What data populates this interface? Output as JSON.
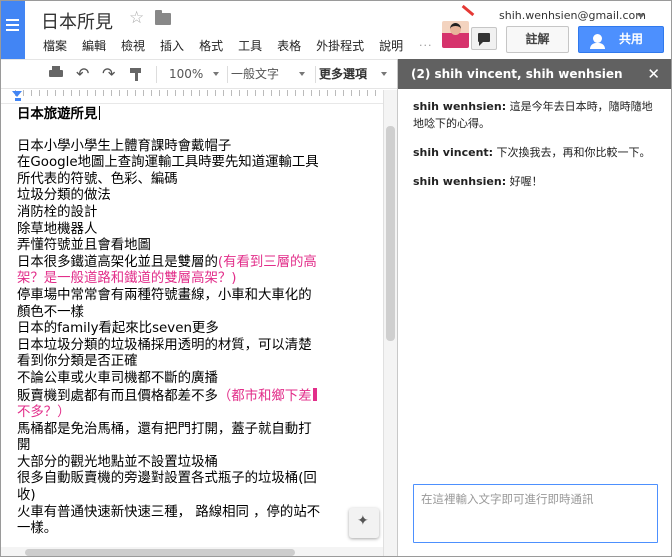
{
  "doc": {
    "title": "日本所見",
    "heading": "日本旅遊所見",
    "lines": [
      {
        "text": "日本小學小學生上體育課時會戴帽子"
      },
      {
        "text": "在Google地圖上查詢運輸工具時要先知道運輸工具"
      },
      {
        "text": "所代表的符號、色彩、編碼"
      },
      {
        "text": "垃圾分類的做法"
      },
      {
        "text": "消防栓的設計"
      },
      {
        "text": "除草地機器人"
      },
      {
        "text": "弄懂符號並且會看地圖"
      },
      {
        "text": "日本很多鐵道高架化並且是雙層的",
        "pink": "(有看到三層的高"
      },
      {
        "pink": "架？是一般道路和鐵道的雙層高架？)"
      },
      {
        "text": "停車場中常常會有兩種符號畫線，小車和大車化的"
      },
      {
        "text": "顏色不一樣"
      },
      {
        "text": "日本的family看起來比seven更多"
      },
      {
        "text": "日本垃圾分類的垃圾桶採用透明的材質，可以清楚"
      },
      {
        "text": "看到你分類是否正確"
      },
      {
        "text": "不論公車或火車司機都不斷的廣播"
      },
      {
        "text": "販賣機到處都有而且價格都差不多",
        "pink": "（都市和鄉下差",
        "cursor": true
      },
      {
        "pink": "不多？）"
      },
      {
        "text": "馬桶都是免治馬桶，還有把門打開，蓋子就自動打"
      },
      {
        "text": "開"
      },
      {
        "text": "大部分的觀光地點並不設置垃圾桶"
      },
      {
        "text": "很多自動販賣機的旁邊對設置各式瓶子的垃圾桶(回"
      },
      {
        "text": "收)"
      },
      {
        "text": "火車有普通快速新快速三種， 路線相同 ，停的站不"
      },
      {
        "text": "一樣。"
      }
    ]
  },
  "menu": [
    "檔案",
    "編輯",
    "檢視",
    "插入",
    "格式",
    "工具",
    "表格",
    "外掛程式",
    "說明"
  ],
  "header": {
    "email": "shih.wenhsien@gmail.com",
    "more": "···",
    "comments_label": "註解",
    "share_label": "共用"
  },
  "toolbar": {
    "zoom": "100%",
    "style": "一般文字",
    "more": "更多選項"
  },
  "chat": {
    "title": "(2) shih vincent, shih wenhsien",
    "close": "✕",
    "messages": [
      {
        "author": "shih wenhsien:",
        "text": " 這是今年去日本時，隨時隨地地唸下的心得。"
      },
      {
        "author": "shih vincent:",
        "text": " 下次換我去，再和你比較一下。"
      },
      {
        "author": "shih wenhsien:",
        "text": " 好喔！"
      }
    ],
    "input_placeholder": "在這裡輸入文字即可進行即時通訊"
  },
  "colors": {
    "accent": "#4d90fe",
    "docs_blue": "#4285f4",
    "comment_pink": "#e22e8a",
    "chat_header": "#616161"
  },
  "icons": [
    "docs-logo-icon",
    "star-icon",
    "folder-icon",
    "caret-down-icon",
    "avatar",
    "arrow-icon",
    "chat-icon",
    "person-icon",
    "print-icon",
    "undo-icon",
    "redo-icon",
    "paint-format-icon",
    "close-icon",
    "explore-icon"
  ]
}
